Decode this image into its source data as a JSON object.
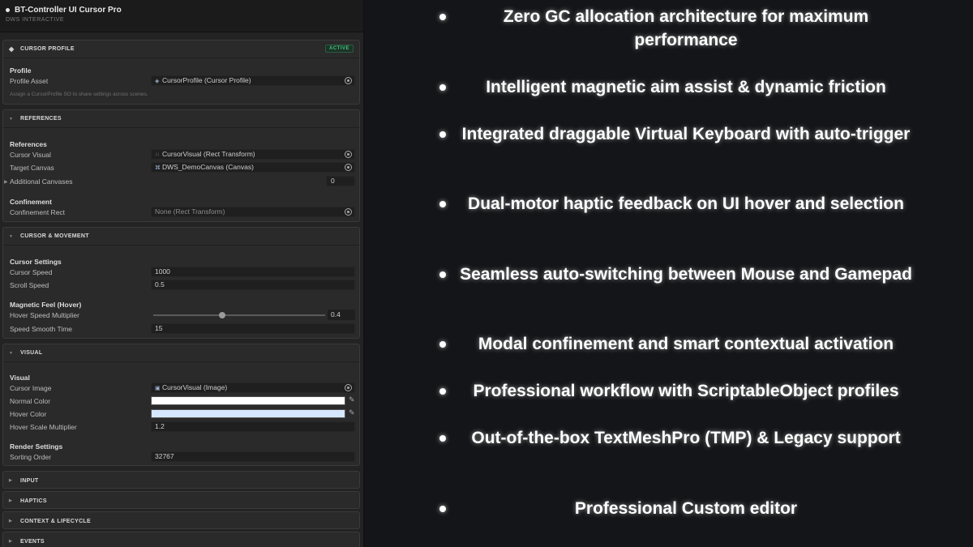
{
  "window": {
    "title": "BT-Controller UI Cursor Pro",
    "subtitle": "DWS INTERACTIVE"
  },
  "sections": {
    "cursor_profile": {
      "title": "CURSOR PROFILE",
      "badge": "ACTIVE",
      "group": "Profile",
      "profile_asset_label": "Profile Asset",
      "profile_asset_value": "CursorProfile (Cursor Profile)",
      "help": "Assign a CursorProfile SO to share settings across scenes."
    },
    "references": {
      "title": "REFERENCES",
      "group": "References",
      "cursor_visual_label": "Cursor Visual",
      "cursor_visual_value": "CursorVisual (Rect Transform)",
      "target_canvas_label": "Target Canvas",
      "target_canvas_value": "DWS_DemoCanvas (Canvas)",
      "additional_canvases_label": "Additional Canvases",
      "additional_canvases_value": "0",
      "confinement_group": "Confinement",
      "confinement_rect_label": "Confinement Rect",
      "confinement_rect_value": "None (Rect Transform)"
    },
    "cursor_movement": {
      "title": "CURSOR & MOVEMENT",
      "group": "Cursor Settings",
      "cursor_speed_label": "Cursor Speed",
      "cursor_speed_value": "1000",
      "scroll_speed_label": "Scroll Speed",
      "scroll_speed_value": "0.5",
      "magnetic_group": "Magnetic Feel (Hover)",
      "hover_speed_label": "Hover Speed Multiplier",
      "hover_speed_value": "0.4",
      "hover_speed_fraction": 0.4,
      "smooth_time_label": "Speed Smooth Time",
      "smooth_time_value": "15"
    },
    "visual": {
      "title": "VISUAL",
      "group": "Visual",
      "cursor_image_label": "Cursor Image",
      "cursor_image_value": "CursorVisual (Image)",
      "normal_color_label": "Normal Color",
      "normal_color": "#ffffff",
      "hover_color_label": "Hover Color",
      "hover_color": "#d6e8ff",
      "hover_scale_label": "Hover Scale Multiplier",
      "hover_scale_value": "1.2",
      "render_group": "Render Settings",
      "sorting_order_label": "Sorting Order",
      "sorting_order_value": "32767"
    },
    "input": {
      "title": "INPUT"
    },
    "haptics": {
      "title": "HAPTICS"
    },
    "context": {
      "title": "CONTEXT & LIFECYCLE"
    },
    "events": {
      "title": "EVENTS"
    }
  },
  "features": [
    "Zero GC allocation architecture for maximum performance",
    "Intelligent magnetic aim assist & dynamic friction",
    "Integrated draggable Virtual Keyboard with auto-trigger",
    "Dual-motor haptic feedback on UI hover and selection",
    "Seamless auto-switching between Mouse and Gamepad",
    "Modal confinement and smart contextual activation",
    "Professional workflow with ScriptableObject profiles",
    "Out-of-the-box TextMeshPro (TMP) & Legacy support",
    "Professional Custom editor"
  ],
  "colors": {
    "active_badge": "#3fc47a",
    "panel_bg": "#232323",
    "page_bg": "#141518"
  },
  "icons": {
    "profile_section": "diamond-icon",
    "foldout": "triangle-icon",
    "object_picker": "circle-target-icon",
    "eyedropper": "eyedropper-icon"
  }
}
